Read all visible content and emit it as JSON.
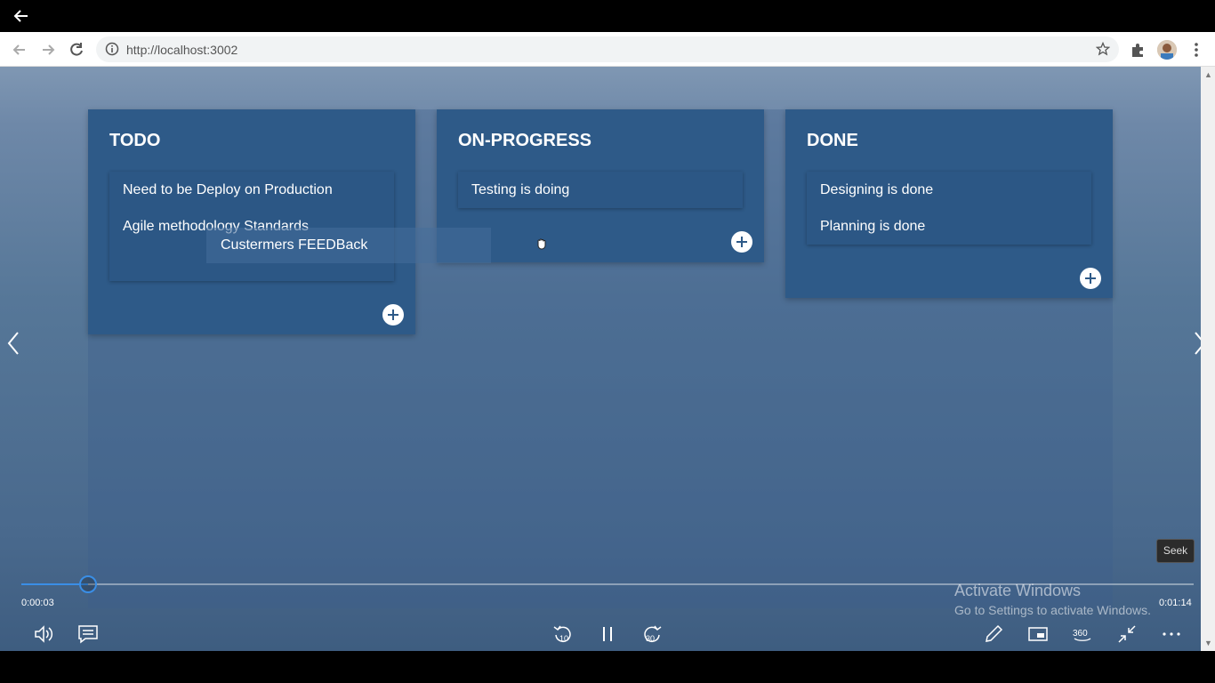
{
  "browser": {
    "url": "http://localhost:3002"
  },
  "board": {
    "columns": [
      {
        "title": "TODO",
        "cards": [
          "Need to be Deploy on Production",
          "Agile methodology Standards"
        ]
      },
      {
        "title": "ON-PROGRESS",
        "cards": [
          "Testing is doing"
        ]
      },
      {
        "title": "DONE",
        "cards": [
          "Designing is done",
          "Planning is done"
        ]
      }
    ],
    "dragging_card": "Custermers FEEDBack"
  },
  "player": {
    "tooltip": "Seek",
    "current_time": "0:00:03",
    "total_time": "0:01:14",
    "progress": 0.057,
    "skip_back_label": "10",
    "skip_forward_label": "30",
    "view_360_label": "360"
  },
  "watermark": {
    "title": "Activate Windows",
    "subtitle": "Go to Settings to activate Windows."
  },
  "colors": {
    "accent": "#3a8ee6",
    "column_bg": "#2e5a88"
  }
}
